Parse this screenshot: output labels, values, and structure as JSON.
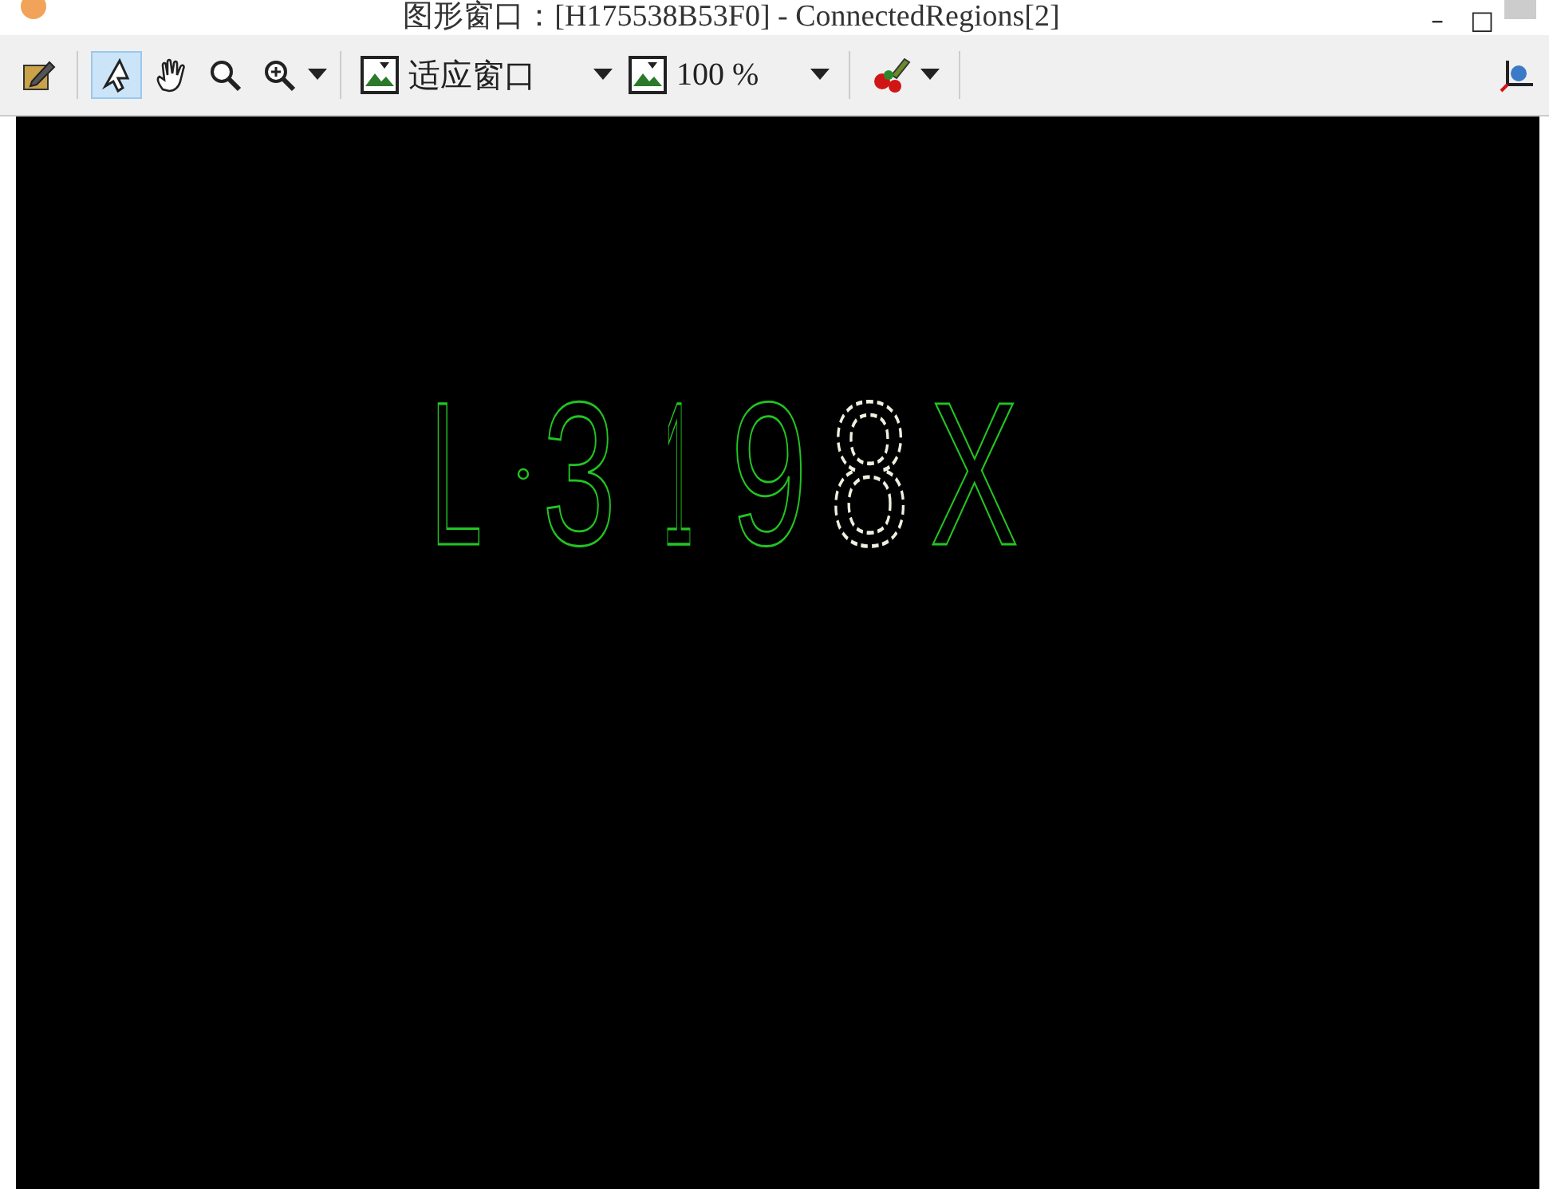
{
  "window": {
    "title": "图形窗口：[H175538B53F0] - ConnectedRegions[2]",
    "controls": [
      "–",
      "□"
    ]
  },
  "toolbar": {
    "tools": [
      {
        "kind": "edit",
        "selected": false
      },
      {
        "kind": "pointer",
        "selected": true
      },
      {
        "kind": "hand",
        "selected": false
      },
      {
        "kind": "zoom",
        "selected": false
      },
      {
        "kind": "zoom-in",
        "selected": false
      }
    ],
    "fit": {
      "label": "适应窗口"
    },
    "zoom": {
      "value": "100 %"
    }
  },
  "regions": [
    {
      "kind": "glyph",
      "text": "L",
      "selected": false
    },
    {
      "kind": "dot",
      "selected": false
    },
    {
      "kind": "glyph",
      "text": "3",
      "selected": false
    },
    {
      "kind": "glyph",
      "text": "1",
      "selected": false
    },
    {
      "kind": "glyph",
      "text": "9",
      "selected": false
    },
    {
      "kind": "glyph",
      "text": "8",
      "selected": true
    },
    {
      "kind": "glyph",
      "text": "X",
      "selected": false
    }
  ]
}
